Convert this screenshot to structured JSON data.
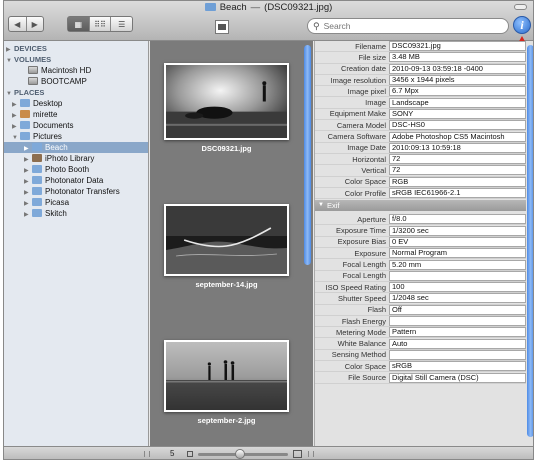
{
  "window": {
    "title_folder": "Beach",
    "title_sep": "—",
    "title_file": "(DSC09321.jpg)"
  },
  "toolbar": {
    "back_icon": "back-arrow-icon",
    "forward_icon": "forward-arrow-icon",
    "view_thumb_label": "▦",
    "view_grid_label": "⠿⠿",
    "view_list_label": "☰",
    "search_placeholder": "Search",
    "info_label": "i"
  },
  "sidebar": {
    "sections": [
      {
        "label": "DEVICES",
        "expanded": false
      },
      {
        "label": "VOLUMES",
        "expanded": true
      },
      {
        "label": "PLACES",
        "expanded": true
      }
    ],
    "volumes": [
      "Macintosh HD",
      "BOOTCAMP"
    ],
    "places": [
      {
        "label": "Desktop",
        "indent": 1,
        "expandable": true,
        "icon": "folder-icon"
      },
      {
        "label": "mirette",
        "indent": 1,
        "expandable": true,
        "icon": "home-icon"
      },
      {
        "label": "Documents",
        "indent": 1,
        "expandable": true,
        "icon": "folder-icon"
      },
      {
        "label": "Pictures",
        "indent": 1,
        "expandable": true,
        "expanded": true,
        "icon": "folder-icon"
      },
      {
        "label": "Beach",
        "indent": 2,
        "expandable": true,
        "selected": true,
        "icon": "folder-icon"
      },
      {
        "label": "iPhoto Library",
        "indent": 2,
        "expandable": true,
        "icon": "iphoto-icon"
      },
      {
        "label": "Photo Booth",
        "indent": 2,
        "expandable": true,
        "icon": "folder-icon"
      },
      {
        "label": "Photonator Data",
        "indent": 2,
        "expandable": true,
        "icon": "folder-icon"
      },
      {
        "label": "Photonator Transfers",
        "indent": 2,
        "expandable": true,
        "icon": "folder-icon"
      },
      {
        "label": "Picasa",
        "indent": 2,
        "expandable": true,
        "icon": "folder-icon"
      },
      {
        "label": "Skitch",
        "indent": 2,
        "expandable": true,
        "icon": "folder-icon"
      }
    ]
  },
  "thumbnails": [
    {
      "caption": "DSC09321.jpg",
      "scene": "sunset"
    },
    {
      "caption": "september-14.jpg",
      "scene": "rope"
    },
    {
      "caption": "september-2.jpg",
      "scene": "silhouettes"
    }
  ],
  "info": {
    "rows": [
      {
        "label": "Filename",
        "value": "DSC09321.jpg"
      },
      {
        "label": "File size",
        "value": "3.48 MB"
      },
      {
        "label": "Creation date",
        "value": "2010-09-13 03:59:18 -0400"
      },
      {
        "label": "Image resolution",
        "value": "3456 x 1944 pixels"
      },
      {
        "label": "Image pixel",
        "value": "6.7 Mpx"
      },
      {
        "label": "Image",
        "value": "Landscape"
      },
      {
        "label": "Equipment Make",
        "value": "SONY"
      },
      {
        "label": "Camera Model",
        "value": "DSC-HS0"
      },
      {
        "label": "Camera Software",
        "value": "Adobe Photoshop CS5 Macintosh"
      },
      {
        "label": "Image Date",
        "value": "2010:09:13 10:59:18"
      },
      {
        "label": "Horizontal",
        "value": "72"
      },
      {
        "label": "Vertical",
        "value": "72"
      },
      {
        "label": "Color Space",
        "value": "RGB"
      },
      {
        "label": "Color Profile",
        "value": "sRGB IEC61966-2.1"
      }
    ],
    "exif_header": "Exif",
    "exif_rows": [
      {
        "label": "Aperture",
        "value": "f/8.0"
      },
      {
        "label": "Exposure Time",
        "value": "1/3200 sec"
      },
      {
        "label": "Exposure Bias",
        "value": "0 EV"
      },
      {
        "label": "Exposure",
        "value": "Normal Program"
      },
      {
        "label": "Focal Length",
        "value": "5.20 mm"
      },
      {
        "label": "Focal Length",
        "value": ""
      },
      {
        "label": "ISO Speed Rating",
        "value": "100"
      },
      {
        "label": "Shutter Speed",
        "value": "1/2048 sec"
      },
      {
        "label": "Flash",
        "value": "Off"
      },
      {
        "label": "Flash Energy",
        "value": ""
      },
      {
        "label": "Metering Mode",
        "value": "Pattern"
      },
      {
        "label": "White Balance",
        "value": "Auto"
      },
      {
        "label": "Sensing Method",
        "value": ""
      },
      {
        "label": "Color Space",
        "value": "sRGB"
      },
      {
        "label": "File Source",
        "value": "Digital Still Camera (DSC)"
      }
    ]
  },
  "bottombar": {
    "zoom_value": "5"
  },
  "colors": {
    "selection": "#8aa7c9",
    "sidebar_bg": "#e4e9f0",
    "thumb_bg": "#7b7b7b",
    "annotation_arrow": "#d8261b",
    "scroll_blue": "#4e8be6"
  }
}
